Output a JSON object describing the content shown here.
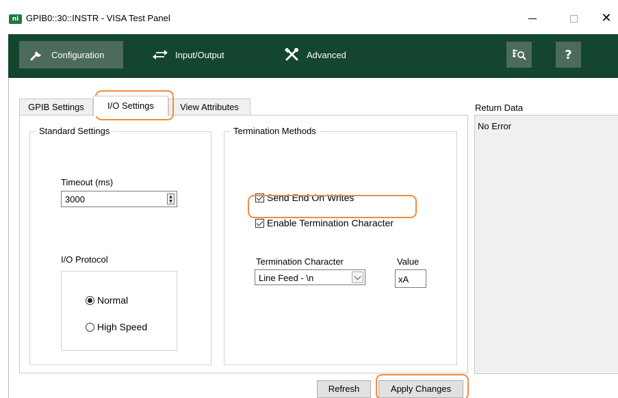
{
  "window": {
    "title": "GPIB0::30::INSTR - VISA Test Panel",
    "logo_text": "ni",
    "minimize_label": "—",
    "maximize_label": "□",
    "close_label": "✕"
  },
  "toolbar": {
    "configuration_label": "Configuration",
    "input_output_label": "Input/Output",
    "advanced_label": "Advanced",
    "help_label": "?",
    "icons": {
      "configuration": "wrench-icon",
      "input_output": "arrows-exchange-icon",
      "advanced": "tools-crossed-icon",
      "find": "find-resource-icon"
    }
  },
  "tabs": [
    {
      "label": "GPIB Settings"
    },
    {
      "label": "I/O Settings",
      "selected": true
    },
    {
      "label": "View Attributes"
    }
  ],
  "standard_settings": {
    "title": "Standard Settings",
    "timeout_label": "Timeout (ms)",
    "timeout_value": "3000",
    "io_protocol_label": "I/O Protocol",
    "protocol_options": [
      {
        "label": "Normal",
        "selected": true
      },
      {
        "label": "High Speed",
        "selected": false
      }
    ]
  },
  "termination_methods": {
    "title": "Termination Methods",
    "send_end_label": "Send End On Writes",
    "send_end_checked": true,
    "enable_term_char_label": "Enable Termination Character",
    "enable_term_char_checked": true,
    "term_char_label": "Termination Character",
    "term_char_value": "Line Feed - \\n",
    "value_label": "Value",
    "value_value": "xA"
  },
  "return_data": {
    "label": "Return Data",
    "text": "No Error"
  },
  "buttons": {
    "refresh_label": "Refresh",
    "apply_label": "Apply Changes"
  },
  "colors": {
    "toolbar_bg": "#14452e",
    "toolbar_active": "#4c6b5b",
    "highlight": "#f08a3c"
  }
}
